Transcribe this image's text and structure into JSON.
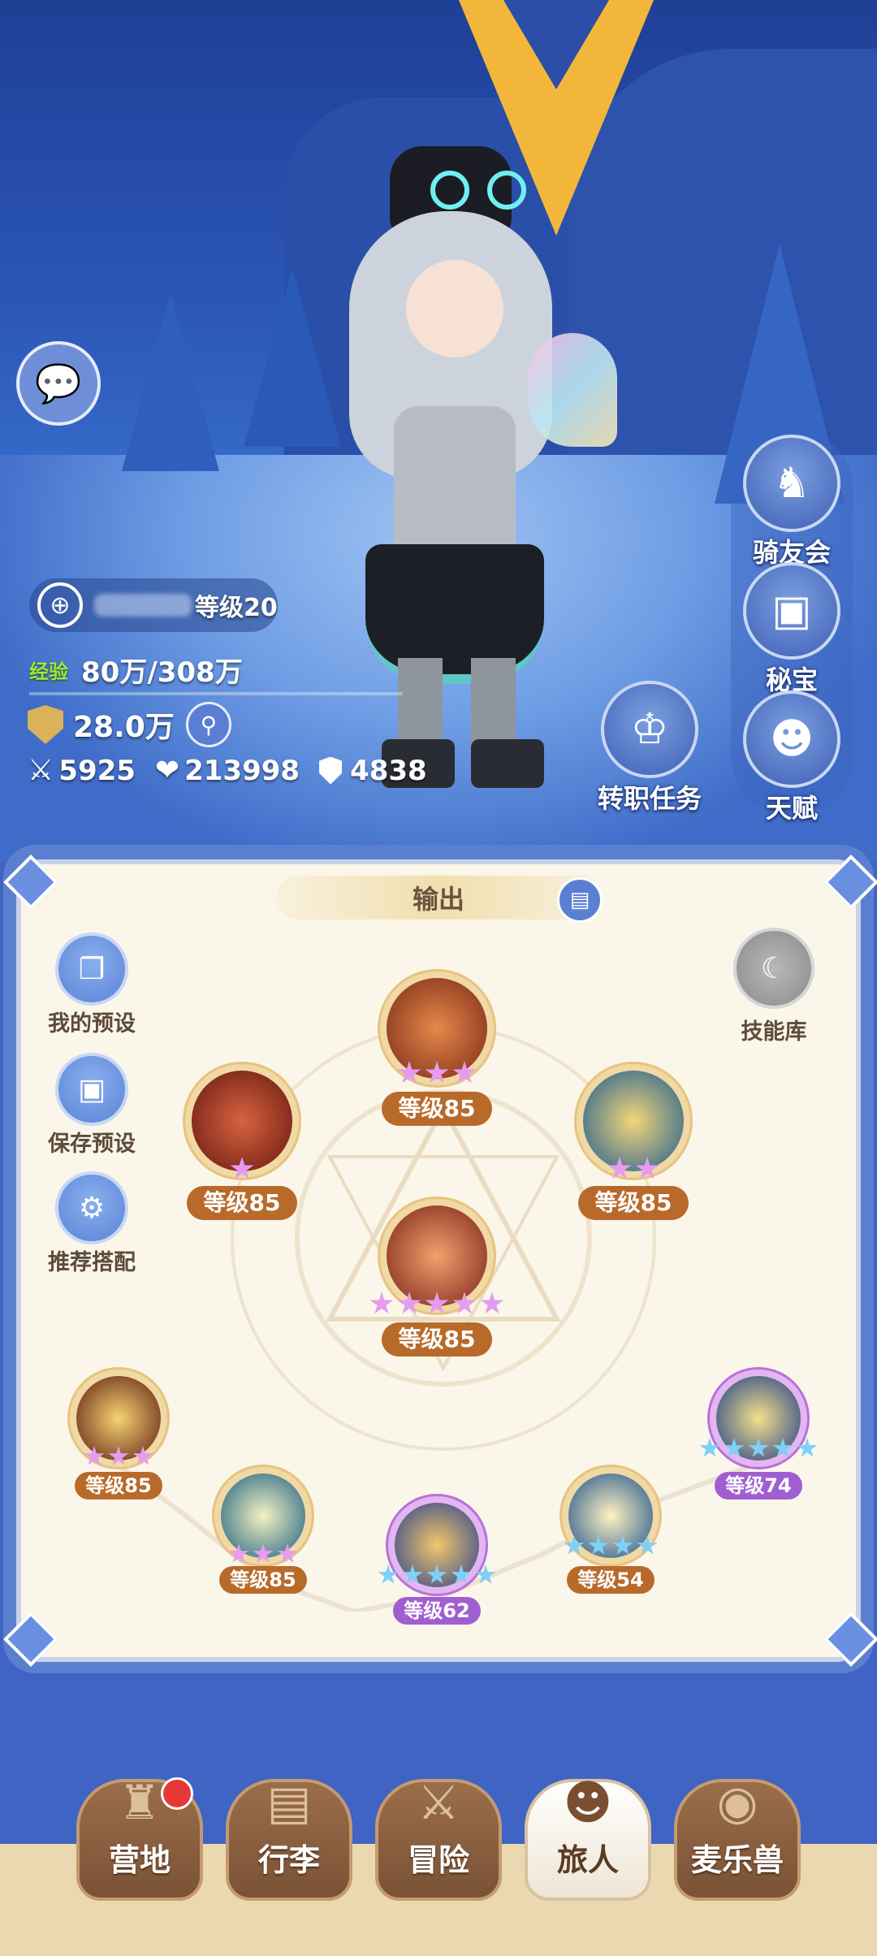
{
  "player": {
    "level_text": "等级20",
    "exp_label": "经验",
    "exp_value": "80万/308万",
    "power": "28.0万",
    "attack": "5925",
    "hp": "213998",
    "defense": "4838"
  },
  "side_buttons": {
    "rider_club": "骑友会",
    "treasure": "秘宝",
    "talent": "天赋",
    "job_quest": "转职任务"
  },
  "panel": {
    "tab_title": "输出",
    "my_presets": "我的预设",
    "save_preset": "保存预设",
    "recommended": "推荐搭配",
    "skill_library": "技能库"
  },
  "skills": {
    "top": {
      "level": "等级85",
      "stars": 3
    },
    "left": {
      "level": "等级85",
      "stars": 1
    },
    "right": {
      "level": "等级85",
      "stars": 2
    },
    "center": {
      "level": "等级85",
      "stars": 5
    },
    "bottom": [
      {
        "level": "等级85",
        "stars": 3,
        "color": "pink",
        "frame": "gold"
      },
      {
        "level": "等级85",
        "stars": 3,
        "color": "pink",
        "frame": "gold"
      },
      {
        "level": "等级62",
        "stars": 5,
        "color": "blue",
        "frame": "purple"
      },
      {
        "level": "等级54",
        "stars": 4,
        "color": "blue",
        "frame": "gold"
      },
      {
        "level": "等级74",
        "stars": 5,
        "color": "blue",
        "frame": "purple"
      }
    ]
  },
  "nav": {
    "camp": "营地",
    "luggage": "行李",
    "adventure": "冒险",
    "traveler": "旅人",
    "pets": "麦乐兽"
  },
  "colors": {
    "panel_bg": "#fbf6ea",
    "level_badge": "#b86a2b",
    "level_badge_purple": "#a05fd0",
    "notification": "#e53935"
  }
}
